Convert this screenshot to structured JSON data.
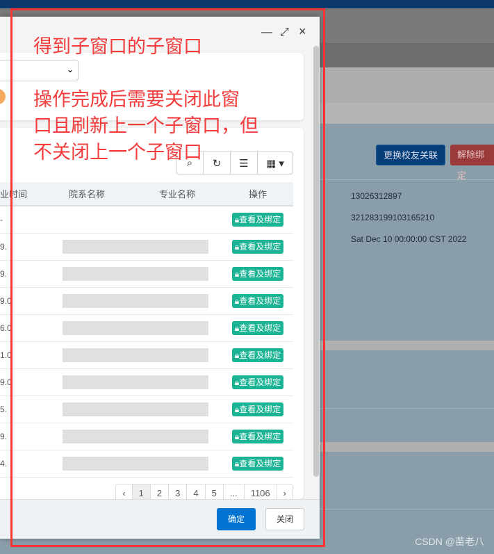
{
  "background": {
    "buttons": {
      "change_link": "更换校友关联",
      "unbind": "解除绑定"
    },
    "details": [
      "13026312897",
      "321283199103165210",
      "Sat Dec 10 00:00:00 CST 2022"
    ]
  },
  "modal": {
    "controls": {
      "minimize": "—",
      "maximize": "⤢",
      "close": "×"
    },
    "toolbar_icons": [
      "search-icon",
      "refresh-icon",
      "list-icon",
      "columns-icon"
    ],
    "table": {
      "headers": [
        "业时间",
        "院系名称",
        "专业名称",
        "操作"
      ],
      "rows": [
        {
          "col1": "-",
          "action": "查看及绑定"
        },
        {
          "col1": "9.",
          "action": "查看及绑定"
        },
        {
          "col1": "9.",
          "action": "查看及绑定"
        },
        {
          "col1": "9.0",
          "action": "查看及绑定"
        },
        {
          "col1": "6.0",
          "action": "查看及绑定"
        },
        {
          "col1": "1.0",
          "action": "查看及绑定"
        },
        {
          "col1": "9.0",
          "action": "查看及绑定"
        },
        {
          "col1": "5.",
          "action": "查看及绑定"
        },
        {
          "col1": "9.",
          "action": "查看及绑定"
        },
        {
          "col1": "4.",
          "action": "查看及绑定"
        }
      ]
    },
    "pagination": {
      "prev": "‹",
      "pages": [
        "1",
        "2",
        "3",
        "4",
        "5",
        "...",
        "1106"
      ],
      "next": "›",
      "current": "1"
    },
    "footer": {
      "ok": "确定",
      "close": "关闭"
    }
  },
  "annotation": {
    "line1": "得到子窗口的子窗口",
    "line2": "操作完成后需要关闭此窗",
    "line3": "口且刷新上一个子窗口，但",
    "line4": "不关闭上一个子窗口"
  },
  "watermark": "CSDN @苗老八",
  "colors": {
    "accent": "#1ab394",
    "primary": "#0072d2",
    "annotation": "#f23b3b"
  }
}
